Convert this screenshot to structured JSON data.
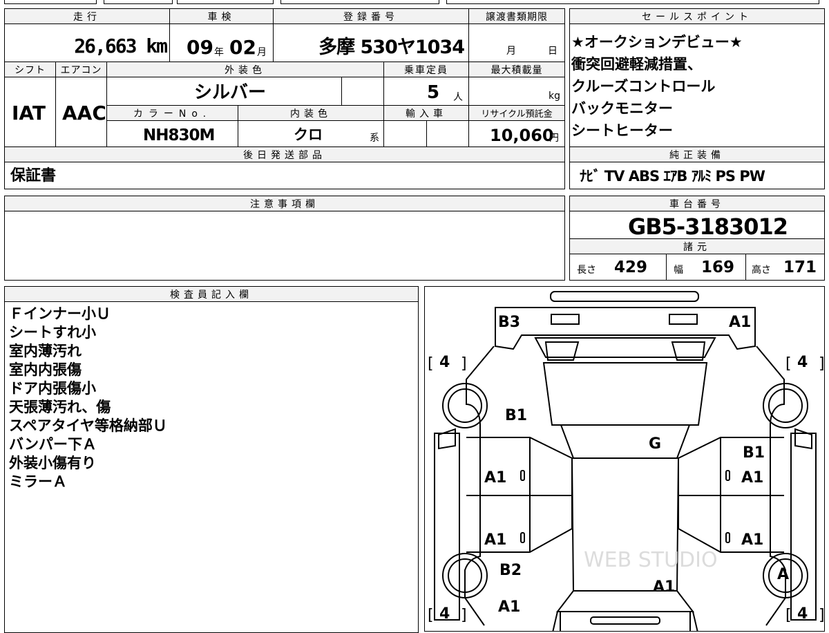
{
  "header": {
    "mileage_label": "走行",
    "shaken_label": "車検",
    "reg_no_label": "登録番号",
    "transfer_deadline_label": "譲渡書類期限",
    "sales_points_label": "セールスポイント"
  },
  "row1": {
    "mileage": "26,663 km",
    "shaken_year": "09",
    "shaken_year_unit": "年",
    "shaken_month": "02",
    "shaken_month_unit": "月",
    "reg_no": "多摩 530ヤ1034",
    "transfer_month": "月",
    "transfer_day": "日"
  },
  "row2_labels": {
    "shift": "シフト",
    "aircon": "エアコン",
    "exterior_color": "外装色",
    "capacity": "乗車定員",
    "max_load": "最大積載量",
    "color_no": "カラーNo.",
    "interior_color": "内装色",
    "import": "輸入車",
    "recycle": "リサイクル預託金"
  },
  "row2": {
    "shift": "IAT",
    "aircon": "AAC",
    "exterior_color": "シルバー",
    "capacity": "5",
    "capacity_unit": "人",
    "max_load_unit": "kg",
    "color_no": "NH830M",
    "interior_color": "クロ",
    "interior_suffix": "系",
    "recycle": "10,060",
    "recycle_unit": "円"
  },
  "sales_points": [
    "★オークションデビュー★",
    "衝突回避軽減措置、",
    "クルーズコントロール",
    "バックモニター",
    "シートヒーター"
  ],
  "later_parts": {
    "label": "後日発送部品",
    "value": "保証書"
  },
  "genuine_equipment": {
    "label": "純正装備",
    "value": "ﾅﾋﾞ TV ABS ｴｱB ｱﾙﾐ PS PW"
  },
  "notes": {
    "label": "注意事項欄",
    "value": ""
  },
  "chassis": {
    "label": "車台番号",
    "value": "GB5-3183012",
    "specs_label": "諸元",
    "length_label": "長さ",
    "length": "429",
    "width_label": "幅",
    "width": "169",
    "height_label": "高さ",
    "height": "171"
  },
  "inspector": {
    "label": "検査員記入欄",
    "lines": [
      "Ｆインナー小Ｕ",
      "シートすれ小",
      "室内薄汚れ",
      "室内内張傷",
      "ドア内張傷小",
      "天張薄汚れ、傷",
      "スペアタイヤ等格納部Ｕ",
      "バンパー下Ａ",
      "外装小傷有り",
      "ミラーＡ"
    ]
  },
  "diagram": {
    "tire_rating": "4",
    "marks": {
      "rear_left": "B3",
      "rear_right": "A1",
      "left_rear_quarter": "B1",
      "roof": "G",
      "right_rear_quarter": "B1",
      "left_rear_door": "A1",
      "right_rear_door": "A1",
      "left_front_door": "A1",
      "right_front_door": "A1",
      "left_front_fender": "B2",
      "right_front_wheel": "A",
      "hood": "A1",
      "front_left": "A1"
    },
    "door_zero": "0",
    "watermark": "WEB STUDIO"
  }
}
